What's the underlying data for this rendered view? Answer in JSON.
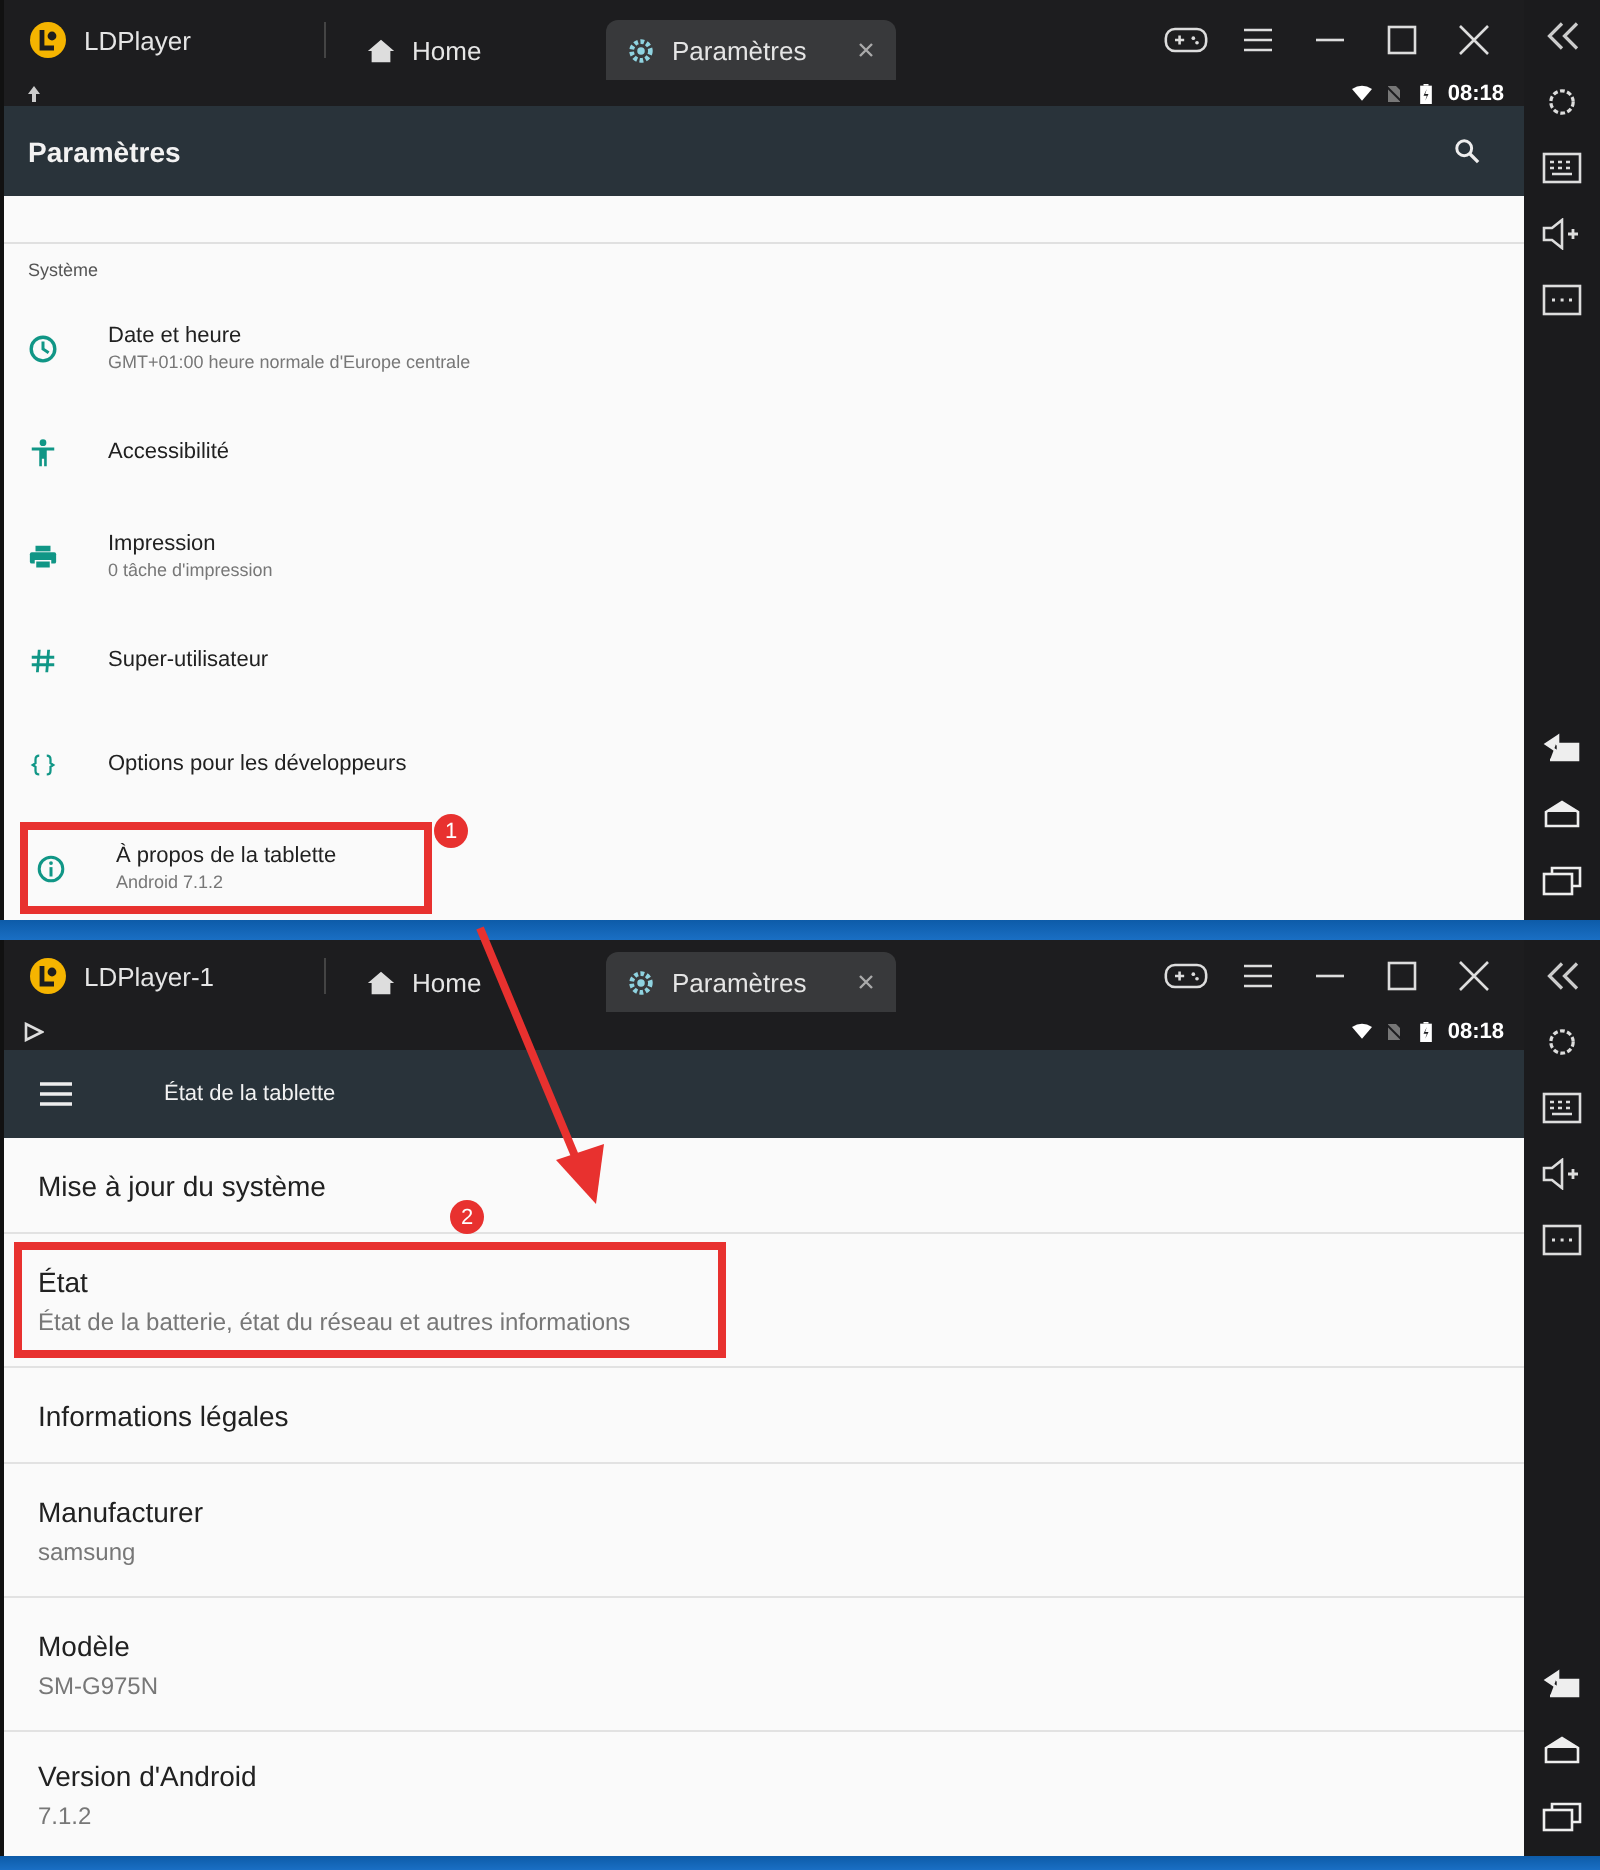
{
  "windows": [
    {
      "kind": "settings_list",
      "app_title": "LDPlayer",
      "tabs": [
        {
          "label": "Home",
          "kind": "home",
          "selected": false
        },
        {
          "label": "Paramètres",
          "kind": "settings",
          "selected": true
        }
      ],
      "status_time": "08:18",
      "toolbar_title": "Paramètres",
      "section": "Système",
      "items": [
        {
          "title": "Date et heure",
          "subtitle": "GMT+01:00 heure normale d'Europe centrale",
          "kind": "clock",
          "highlighted": false
        },
        {
          "title": "Accessibilité",
          "kind": "person",
          "highlighted": false
        },
        {
          "title": "Impression",
          "subtitle": "0 tâche d'impression",
          "kind": "printer",
          "highlighted": false
        },
        {
          "title": "Super-utilisateur",
          "kind": "hash",
          "highlighted": false
        },
        {
          "title": "Options pour les développeurs",
          "kind": "braces",
          "highlighted": false
        },
        {
          "title": "À propos de la tablette",
          "subtitle": "Android 7.1.2",
          "kind": "info",
          "highlighted": true,
          "marker": "1"
        }
      ]
    },
    {
      "kind": "about_list",
      "app_title": "LDPlayer-1",
      "tabs": [
        {
          "label": "Home",
          "kind": "home",
          "selected": false
        },
        {
          "label": "Paramètres",
          "kind": "settings",
          "selected": true
        }
      ],
      "status_time": "08:18",
      "toolbar_title": "État de la tablette",
      "items": [
        {
          "title": "Mise à jour du système",
          "highlighted": false
        },
        {
          "title": "État",
          "subtitle": "État de la batterie, état du réseau et autres informations",
          "highlighted": true,
          "marker": "2"
        },
        {
          "title": "Informations légales",
          "highlighted": false
        },
        {
          "title": "Manufacturer",
          "subtitle": "samsung",
          "highlighted": false
        },
        {
          "title": "Modèle",
          "subtitle": "SM-G975N",
          "highlighted": false
        },
        {
          "title": "Version d'Android",
          "subtitle": "7.1.2",
          "highlighted": false
        }
      ]
    }
  ]
}
